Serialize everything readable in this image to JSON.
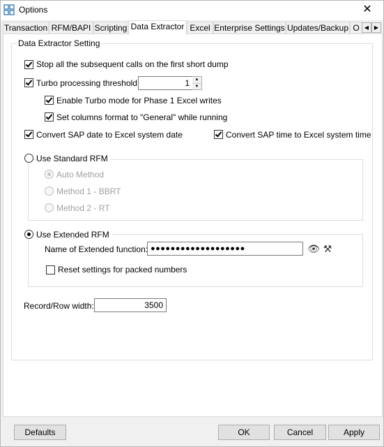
{
  "window": {
    "title": "Options",
    "close_glyph": "✕"
  },
  "tabs": [
    "Transaction",
    "RFM/BAPI",
    "Scripting",
    "Data Extractor",
    "Excel",
    "Enterprise Settings",
    "Updates/Backup",
    "O"
  ],
  "active_tab": "Data Extractor",
  "tab_scroll": {
    "left": "◀",
    "right": "▶"
  },
  "group": {
    "label": "Data Extractor Setting"
  },
  "options": {
    "stop_calls": {
      "label": "Stop all the subsequent calls on the first short dump",
      "checked": true
    },
    "turbo": {
      "label": "Turbo processing threshold",
      "checked": true,
      "value": "1"
    },
    "turbo_phase1": {
      "label": "Enable Turbo mode for Phase 1 Excel writes",
      "checked": true
    },
    "set_columns": {
      "label": "Set columns format to \"General\" while running",
      "checked": true
    },
    "convert_date": {
      "label": "Convert SAP date to Excel system date",
      "checked": true
    },
    "convert_time": {
      "label": "Convert SAP time to Excel system time",
      "checked": true
    }
  },
  "standard_rfm": {
    "label": "Use Standard RFM",
    "selected": false,
    "methods": [
      "Auto Method",
      "Method 1 - BBRT",
      "Method 2 - RT"
    ]
  },
  "extended_rfm": {
    "label": "Use Extended RFM",
    "selected": true,
    "function_label": "Name of Extended function:",
    "function_value": "●●●●●●●●●●●●●●●●●●●",
    "reset_label": "Reset settings for packed numbers",
    "reset_checked": false
  },
  "record_width": {
    "label": "Record/Row width:",
    "value": "3500"
  },
  "buttons": {
    "defaults": "Defaults",
    "ok": "OK",
    "cancel": "Cancel",
    "apply": "Apply"
  },
  "icons": {
    "eye": "👁",
    "tools": "⚒"
  }
}
